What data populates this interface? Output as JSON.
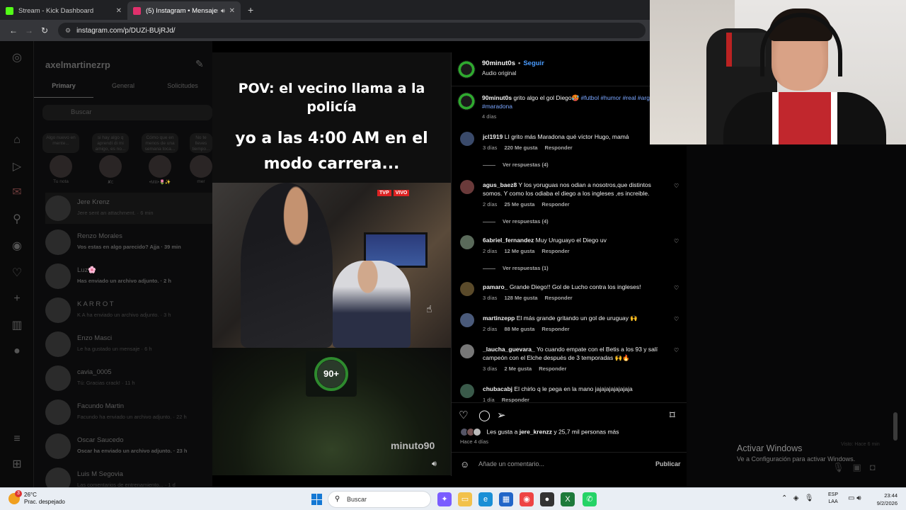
{
  "browser": {
    "tabs": [
      {
        "label": "Stream - Kick Dashboard",
        "favicon_color": "#53fc18",
        "active": false
      },
      {
        "label": "(5) Instagram • Mensajes",
        "favicon_color": "#e1306c",
        "active": true
      }
    ],
    "url": "instagram.com/p/DUZi-BUjRJd/"
  },
  "dm": {
    "username": "axelmartinezrp",
    "tabs": [
      "Primary",
      "General",
      "Solicitudes"
    ],
    "search_placeholder": "Buscar",
    "notes": [
      {
        "bubble": "Algo nuevo en mente...",
        "name": "Tu nota"
      },
      {
        "bubble": "si hay algo q aprendí di mi amigo, es no...",
        "name": "✘ᥴ"
      },
      {
        "bubble": "Cómo que en menos de una semana toca...",
        "name": "•Mili•🌷✨"
      },
      {
        "bubble": "No te lleves tiempo...",
        "name": "mer"
      }
    ],
    "conversations": [
      {
        "name": "Jere Krenz",
        "message": "Jere sent an attachment. · 6 min",
        "unread": false
      },
      {
        "name": "Renzo Morales",
        "message": "Vos estas en algo parecido? Ajja · 39 min",
        "unread": true
      },
      {
        "name": "Luz🌸",
        "message": "Has enviado un archivo adjunto. · 2 h",
        "unread": true
      },
      {
        "name": "K A R R O T",
        "message": "K A ha enviado un archivo adjunto. · 3 h",
        "unread": false
      },
      {
        "name": "Enzo Masci",
        "message": "Le ha gustado un mensaje · 6 h",
        "unread": false
      },
      {
        "name": "cavia_0005",
        "message": "Tú: Gracias crack! · 11 h",
        "unread": false
      },
      {
        "name": "Facundo Martin",
        "message": "Facundo ha enviado un archivo adjunto. · 22 h",
        "unread": false
      },
      {
        "name": "Oscar Saucedo",
        "message": "Oscar ha enviado un archivo adjunto. · 23 h",
        "unread": true
      },
      {
        "name": "Luis M Segovia",
        "message": "Las comentarios de entrenamiento... · 1 d",
        "unread": false
      }
    ]
  },
  "reel": {
    "caption_top": "POV: el vecino llama a la policía",
    "caption_main": "yo a las 4:00 AM en el modo carrera...",
    "tv_channel": "TVP",
    "tv_live": "VIVO",
    "logo_text": "90+",
    "watermark": "minuto90"
  },
  "post": {
    "author": "90minut0s",
    "follow": "Seguir",
    "audio": "Audio original",
    "caption_text": "grito algo el gol Diego🥵",
    "caption_tags": "#futbol #humor #real #argentina #maradona",
    "caption_age": "4 días",
    "comments": [
      {
        "user": "jcl1919",
        "text": "LI grito más Maradona qué víctor Hugo, mamá",
        "age": "3 días",
        "likes": "220 Me gusta",
        "reply": "Responder",
        "replies": "Ver respuestas (4)",
        "avatar": "#3a4a6a"
      },
      {
        "user": "agus_baez8",
        "text": "Y los yoruguas nos odian a nosotros,que distintos somos. Y como los odiaba el diego a los ingleses ,es increible.",
        "age": "2 días",
        "likes": "25 Me gusta",
        "reply": "Responder",
        "replies": "Ver respuestas (4)",
        "avatar": "#6a3a3a"
      },
      {
        "user": "6abriel_fernandez",
        "text": "Muy Uruguayo el Diego uv",
        "age": "2 días",
        "likes": "12 Me gusta",
        "reply": "Responder",
        "replies": "Ver respuestas (1)",
        "avatar": "#5a6a5a"
      },
      {
        "user": "pamaro_",
        "text": "Grande Diego!! Gol de Lucho contra los ingleses!",
        "age": "3 días",
        "likes": "128 Me gusta",
        "reply": "Responder",
        "replies": "",
        "avatar": "#5a4a2a"
      },
      {
        "user": "martinzepp",
        "text": "El más grande gritando un gol de uruguay 🙌",
        "age": "2 días",
        "likes": "88 Me gusta",
        "reply": "Responder",
        "replies": "",
        "avatar": "#4a5a7a"
      },
      {
        "user": "_laucha_guevara_",
        "text": "Yo cuando empate con el Betis a los 93 y salí campeón con el Elche después de 3 temporadas 🙌🔥",
        "age": "3 días",
        "likes": "2 Me gusta",
        "reply": "Responder",
        "replies": "",
        "avatar": "#777777"
      },
      {
        "user": "chubacabj",
        "text": "El chirlo q le pega en la mano jajajajajajajaja",
        "age": "1 día",
        "likes": "",
        "reply": "Responder",
        "replies": "",
        "avatar": "#3a5a4a"
      }
    ],
    "likes_text": "Les gusta a",
    "likes_user": "jere_krenzz",
    "likes_rest": "y 25,7 mil personas más",
    "posted": "Hace 4 días",
    "comment_placeholder": "Añade un comentario...",
    "publish": "Publicar"
  },
  "windows": {
    "activate_title": "Activar Windows",
    "activate_sub": "Ve a Configuración para activar Windows.",
    "visto": "Visto: Hace 6 min"
  },
  "taskbar": {
    "weather_temp": "26°C",
    "weather_desc": "Prac. despejado",
    "weather_badge": "3",
    "search": "Buscar",
    "lang1": "ESP",
    "lang2": "LAA",
    "time": "23:44",
    "date": "9/2/2026"
  }
}
